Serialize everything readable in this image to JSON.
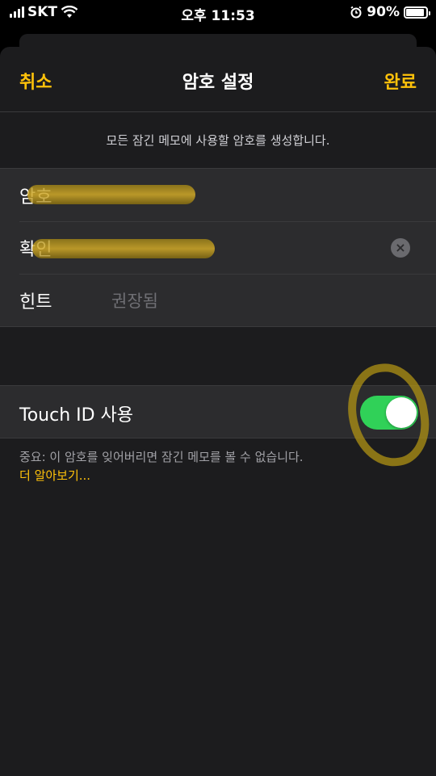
{
  "status_bar": {
    "carrier": "SKT",
    "time": "오후 11:53",
    "battery_pct": "90%",
    "icons": [
      "signal-icon",
      "wifi-icon",
      "alarm-icon",
      "battery-icon"
    ]
  },
  "nav": {
    "cancel_label": "취소",
    "title": "암호 설정",
    "done_label": "완료"
  },
  "description": "모든 잠긴 메모에 사용할 암호를 생성합니다.",
  "fields": {
    "password_label": "암호",
    "verify_label": "확인",
    "hint_label": "힌트",
    "hint_placeholder": "권장됨",
    "clear_icon": "×"
  },
  "touch_id": {
    "label": "Touch ID 사용",
    "enabled": true
  },
  "footer": {
    "note": "중요: 이 암호를 잊어버리면 잠긴 메모를 볼 수 없습니다.",
    "learn_more": "더 알아보기..."
  },
  "colors": {
    "accent": "#ffc20a",
    "toggle_on": "#30d158",
    "background": "#1c1c1e",
    "cell": "#2c2c2e"
  }
}
